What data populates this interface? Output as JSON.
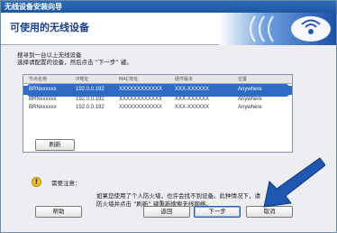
{
  "window": {
    "title": "无线设备安装向导"
  },
  "banner": {
    "heading": "可使用的无线设备"
  },
  "instruction": {
    "line1": "搜寻到一台以上无线设备",
    "line2": "选择请配置的设备，然后点击 “下一步” 键。"
  },
  "table": {
    "columns": [
      "节点名称",
      "IP地址",
      "MAC地址",
      "硬件版本",
      "位置"
    ],
    "rows": [
      [
        "BRNxxxxxx",
        "192.0.0.192",
        "XXXXXXXXXXXX",
        "XXX-XXXXXX",
        "Anywhere"
      ],
      [
        "BRNxxxxxx",
        "192.0.0.192",
        "XXXXXXXXXXXX",
        "XXX-XXXXXX",
        "Anywhere"
      ],
      [
        "BRNxxxxxx",
        "192.0.0.192",
        "XXXXXXXXXXXX",
        "XXX-XXXXXX",
        "Anywhere"
      ]
    ],
    "selected_index": 0
  },
  "buttons": {
    "refresh": "刷新",
    "help": "帮助",
    "back": "返回",
    "next": "下一步",
    "cancel": "取消"
  },
  "notice": {
    "title": "需要注意：",
    "line1": "如果您使用了个人防火墙，也许会找不到设备。此种情况下，请",
    "line2": "防火墙并点击 “刷新” 键重新搜索无线网络。"
  },
  "colors": {
    "titlebar": "#1d56a0",
    "selection": "#3169c6",
    "callout_arrow": "#1f57b0"
  },
  "icons": {
    "banner": "wifi-signal-icon",
    "notice": "warning-icon",
    "callout": "pointer-arrow-icon"
  }
}
